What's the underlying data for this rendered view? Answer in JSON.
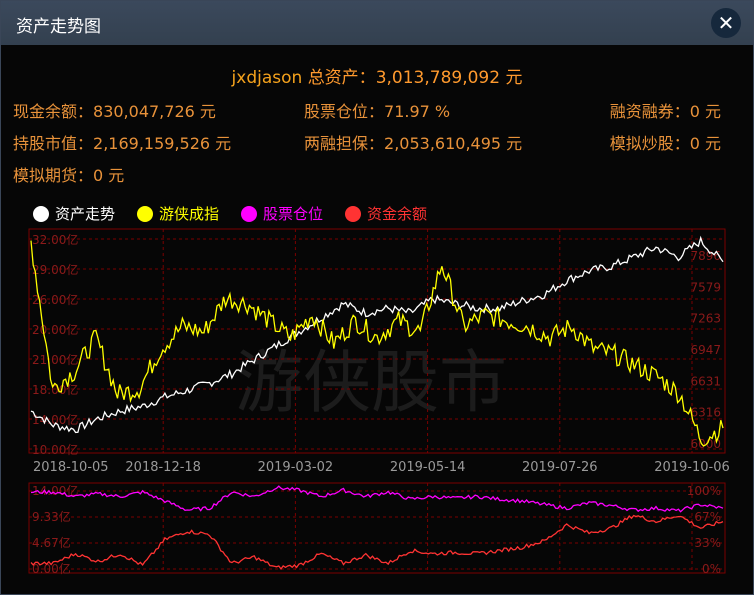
{
  "window": {
    "title": "资产走势图",
    "close_label": "✕"
  },
  "summary": {
    "user": "jxdjason",
    "total_label": "总资产：",
    "total_value": "3,013,789,092 元"
  },
  "stats": [
    {
      "label": "现金余额：",
      "value": "830,047,726 元"
    },
    {
      "label": "股票仓位：",
      "value": "71.97 %"
    },
    {
      "label": "融资融券：",
      "value": "0 元"
    },
    {
      "label": "持股市值：",
      "value": "2,169,159,526 元"
    },
    {
      "label": "两融担保：",
      "value": "2,053,610,495 元"
    },
    {
      "label": "模拟炒股：",
      "value": "0 元"
    },
    {
      "label": "模拟期货：",
      "value": "0 元"
    }
  ],
  "watermark": "游侠股市",
  "colors": {
    "asset": "#ffffff",
    "index": "#ffff00",
    "position": "#ff00ff",
    "cash": "#ff3333",
    "grid": "#7a0000",
    "axis_label": "#8b1a1a"
  },
  "chart_data": [
    {
      "type": "line",
      "legend": [
        "资产走势",
        "游侠成指",
        "股票仓位",
        "资金余额"
      ],
      "x_ticks": [
        "2018-10-05",
        "2018-12-18",
        "2019-03-02",
        "2019-05-14",
        "2019-07-26",
        "2019-10-06"
      ],
      "left_ticks": [
        "32.00亿",
        "29.00亿",
        "26.00亿",
        "20.00亿",
        "21.00亿",
        "18.00亿",
        "14.00亿",
        "10.00亿"
      ],
      "right_ticks": [
        "7896",
        "7579",
        "7263",
        "6947",
        "6631",
        "6316",
        "6000"
      ],
      "series": [
        {
          "name": "资产走势",
          "axis": "left",
          "values": [
            14.0,
            12.5,
            12.0,
            13.2,
            14.0,
            14.5,
            15.5,
            16.2,
            17.0,
            18.0,
            19.5,
            21.0,
            22.5,
            24.0,
            25.5,
            24.5,
            25.0,
            24.5,
            26.0,
            25.5,
            25.0,
            25.0,
            25.8,
            26.5,
            28.0,
            29.0,
            29.5,
            30.5,
            31.5,
            30.5,
            32.2,
            30.0
          ]
        },
        {
          "name": "游侠成指",
          "axis": "right",
          "values": [
            7850,
            6550,
            6700,
            7000,
            6500,
            6550,
            6900,
            7100,
            7050,
            7350,
            7300,
            7150,
            7000,
            7200,
            6950,
            7150,
            7000,
            7150,
            7050,
            7650,
            7100,
            7200,
            7150,
            7100,
            7000,
            7100,
            6900,
            6850,
            6750,
            6650,
            6500,
            6100,
            6200
          ]
        },
        {
          "name": "股票仓位",
          "axis": "right2",
          "range": [
            0,
            100
          ],
          "values": [
            90,
            90,
            85,
            88,
            85,
            90,
            80,
            70,
            72,
            90,
            85,
            95,
            92,
            85,
            92,
            85,
            90,
            82,
            85,
            83,
            85,
            82,
            80,
            76,
            72,
            78,
            75,
            70,
            72,
            69,
            76,
            72
          ]
        },
        {
          "name": "资金余额",
          "axis": "left2",
          "values": [
            1.5,
            1.5,
            3.0,
            1.8,
            3.0,
            1.2,
            5.2,
            6.5,
            6.0,
            1.5,
            2.5,
            0.8,
            1.2,
            3.0,
            1.5,
            2.8,
            1.5,
            3.5,
            3.0,
            3.2,
            3.0,
            3.5,
            4.0,
            5.0,
            7.5,
            6.2,
            7.0,
            9.0,
            8.0,
            9.0,
            7.0,
            8.0
          ]
        }
      ]
    },
    {
      "type": "line",
      "left_ticks": [
        "14.00亿",
        "9.33亿",
        "4.67亿",
        "0.00亿"
      ],
      "right_ticks": [
        "100%",
        "67%",
        "33%",
        "0%"
      ]
    }
  ]
}
